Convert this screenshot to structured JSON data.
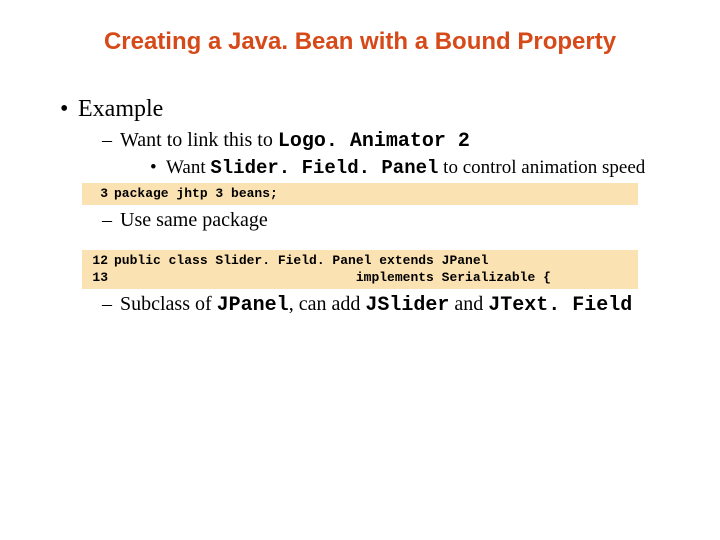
{
  "title": "Creating a Java. Bean with a Bound Property",
  "l1": "Example",
  "l2a_pre": "Want to link this to ",
  "l2a_code": "Logo. Animator 2",
  "l3_pre": "Want ",
  "l3_code": "Slider. Field. Panel",
  "l3_post": " to control animation speed",
  "code1": {
    "ln": "3",
    "text": "package jhtp 3 beans;"
  },
  "l2b": "Use same package",
  "code2a": {
    "ln": "12",
    "text": "public class Slider. Field. Panel extends JPanel"
  },
  "code2b": {
    "ln": "13",
    "text": "                               implements Serializable {"
  },
  "l2c_pre": "Subclass of ",
  "l2c_c1": "JPanel",
  "l2c_mid1": ", can add ",
  "l2c_c2": "JSlider",
  "l2c_mid2": " and ",
  "l2c_c3": "JText. Field"
}
